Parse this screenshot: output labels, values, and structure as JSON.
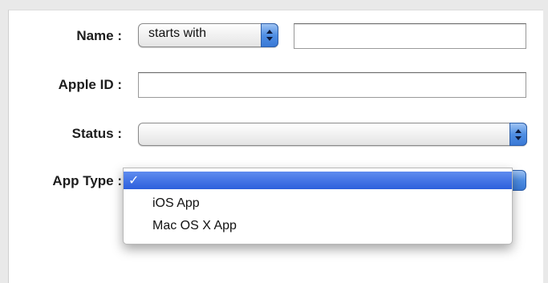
{
  "form": {
    "name": {
      "label": "Name :",
      "operator": "starts with",
      "value": ""
    },
    "apple_id": {
      "label": "Apple ID :",
      "value": ""
    },
    "status": {
      "label": "Status :",
      "value": ""
    },
    "app_type": {
      "label": "App Type :",
      "selected": "",
      "options": [
        "iOS App",
        "Mac OS X App"
      ],
      "selected_marker": "✓"
    }
  },
  "colors": {
    "menu_highlight": "#2c5fdc",
    "stepper": "#4f8ee3"
  },
  "icons": {
    "popup_arrows": "up-down-chevron-icon"
  }
}
